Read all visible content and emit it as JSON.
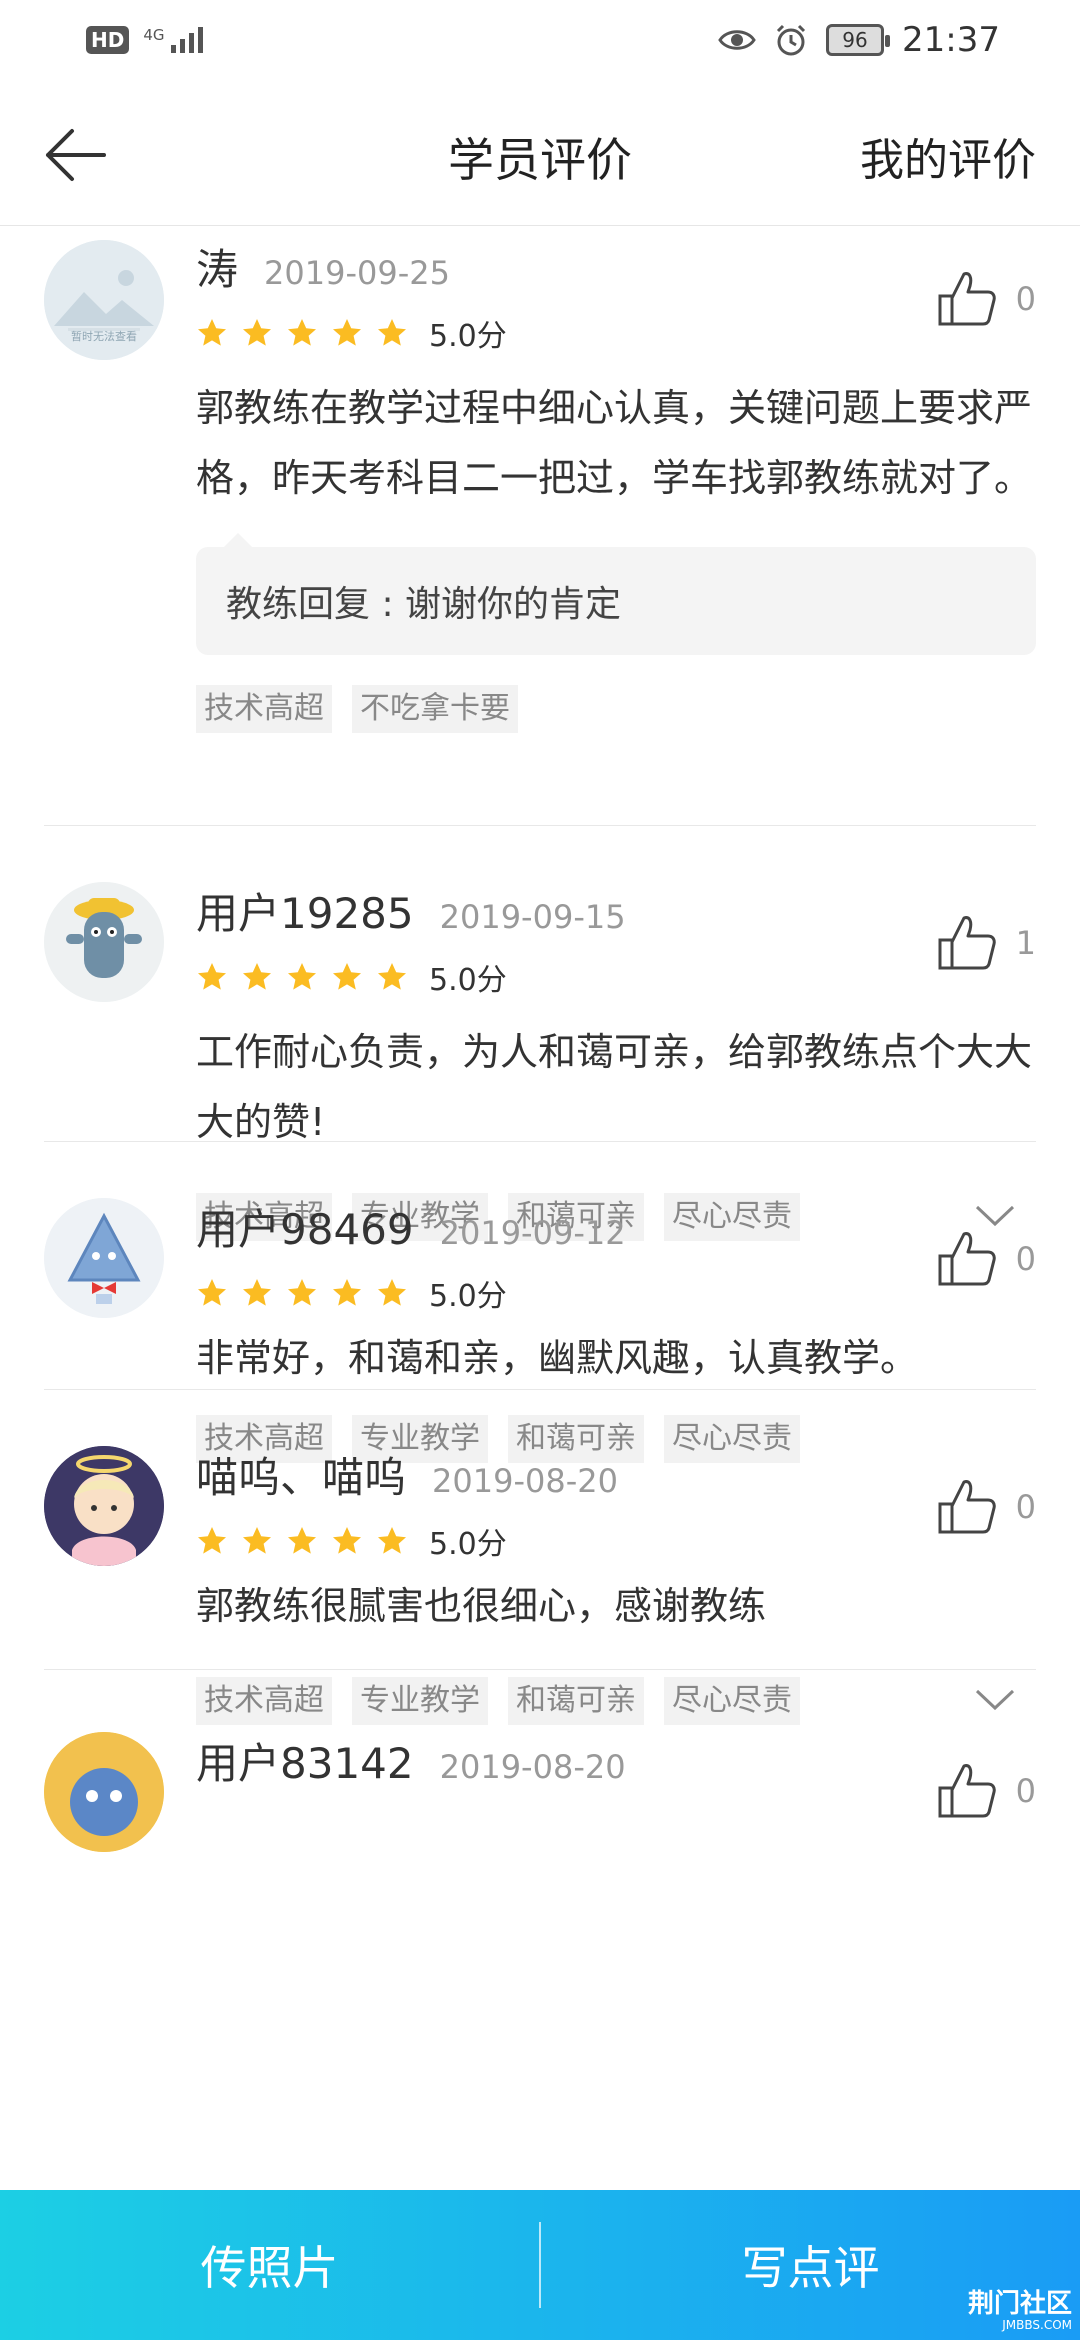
{
  "status": {
    "hd": "HD",
    "network": "4G",
    "battery": "96",
    "time": "21:37"
  },
  "nav": {
    "title": "学员评价",
    "right_label": "我的评价"
  },
  "reviews": [
    {
      "name": "涛",
      "date": "2019-09-25",
      "rating": 5,
      "score": "5.0分",
      "text": "郭教练在教学过程中细心认真，关键问题上要求严格，昨天考科目二一把过，学车找郭教练就对了。",
      "likes": "0",
      "reply": "教练回复 : 谢谢你的肯定",
      "tags": [
        "技术高超",
        "不吃拿卡要"
      ],
      "avatar_caption": "暂时无法查看"
    },
    {
      "name": "用户19285",
      "date": "2019-09-15",
      "rating": 5,
      "score": "5.0分",
      "text": "工作耐心负责，为人和蔼可亲，给郭教练点个大大大的赞!",
      "likes": "1",
      "tags": [
        "技术高超",
        "专业教学",
        "和蔼可亲",
        "尽心尽责"
      ]
    },
    {
      "name": "用户98469",
      "date": "2019-09-12",
      "rating": 5,
      "score": "5.0分",
      "text": "非常好，和蔼和亲，幽默风趣，认真教学。",
      "likes": "0",
      "tags": [
        "技术高超",
        "专业教学",
        "和蔼可亲",
        "尽心尽责"
      ]
    },
    {
      "name": "喵呜、喵呜",
      "date": "2019-08-20",
      "rating": 5,
      "score": "5.0分",
      "text": "郭教练很腻害也很细心，感谢教练",
      "likes": "0",
      "tags": [
        "技术高超",
        "专业教学",
        "和蔼可亲",
        "尽心尽责"
      ]
    },
    {
      "name": "用户83142",
      "date": "2019-08-20",
      "likes": "0"
    }
  ],
  "bottom": {
    "left_label": "传照片",
    "right_label": "写点评"
  },
  "watermark": {
    "main": "荆门社区",
    "sub": "JMBBS.COM"
  },
  "colors": {
    "star": "#fbbc22",
    "bottom_start": "#1ccfe4",
    "bottom_end": "#1a9cf5"
  }
}
